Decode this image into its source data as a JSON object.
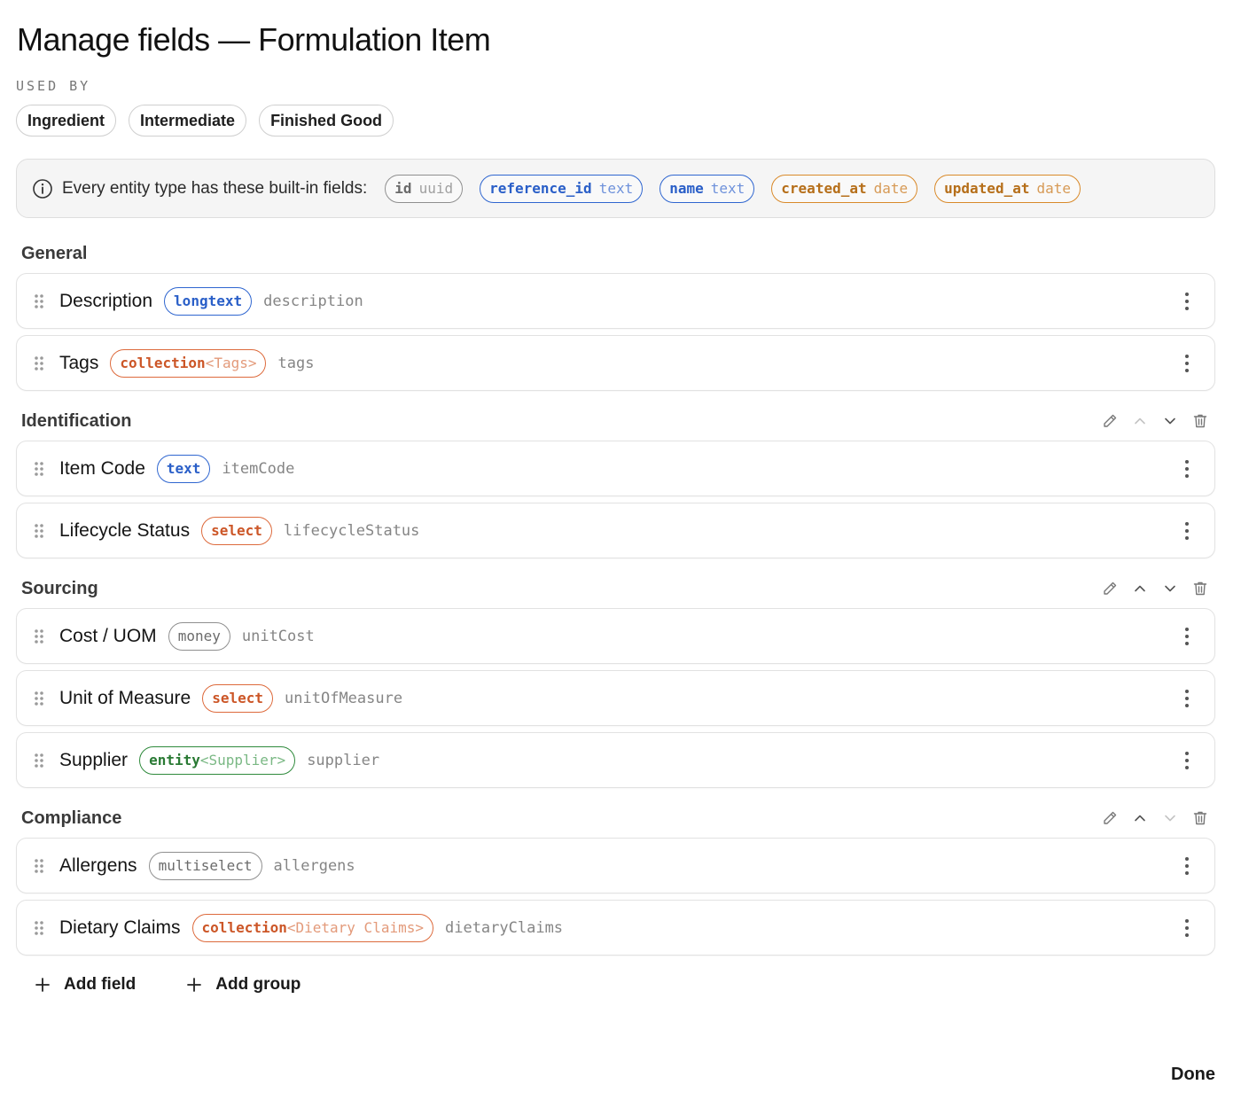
{
  "header": {
    "title": "Manage fields — Formulation Item"
  },
  "used_by": {
    "label": "USED BY",
    "items": [
      "Ingredient",
      "Intermediate",
      "Finished Good"
    ]
  },
  "builtin": {
    "text": "Every entity type has these built-in fields:",
    "fields": [
      {
        "name": "id",
        "type": "uuid",
        "color": "#8f8f8f"
      },
      {
        "name": "reference_id",
        "type": "text",
        "color": "#2f66d0"
      },
      {
        "name": "name",
        "type": "text",
        "color": "#2f66d0"
      },
      {
        "name": "created_at",
        "type": "date",
        "color": "#d98a2a"
      },
      {
        "name": "updated_at",
        "type": "date",
        "color": "#d98a2a"
      }
    ]
  },
  "groups": [
    {
      "title": "General",
      "fields": [
        {
          "label": "Description",
          "type": "longtext",
          "key": "description"
        },
        {
          "label": "Tags",
          "type": "collection",
          "type_arg": "<Tags>",
          "key": "tags"
        }
      ]
    },
    {
      "title": "Identification",
      "fields": [
        {
          "label": "Item Code",
          "type": "text",
          "key": "itemCode"
        },
        {
          "label": "Lifecycle Status",
          "type": "select",
          "key": "lifecycleStatus"
        }
      ]
    },
    {
      "title": "Sourcing",
      "fields": [
        {
          "label": "Cost / UOM",
          "type": "money",
          "key": "unitCost"
        },
        {
          "label": "Unit of Measure",
          "type": "select",
          "key": "unitOfMeasure"
        },
        {
          "label": "Supplier",
          "type": "entity",
          "type_arg": "<Supplier>",
          "key": "supplier"
        }
      ]
    },
    {
      "title": "Compliance",
      "fields": [
        {
          "label": "Allergens",
          "type": "multiselect",
          "key": "allergens"
        },
        {
          "label": "Dietary Claims",
          "type": "collection",
          "type_arg": "<Dietary Claims>",
          "key": "dietaryClaims"
        }
      ]
    }
  ],
  "footer": {
    "add_field": "Add field",
    "add_group": "Add group",
    "done": "Done"
  },
  "icons": {
    "info": "info-icon",
    "drag": "drag-handle-icon",
    "kebab": "more-vertical-icon",
    "edit": "pencil-icon",
    "up": "chevron-up-icon",
    "down": "chevron-down-icon",
    "delete": "trash-icon",
    "plus": "plus-icon"
  }
}
